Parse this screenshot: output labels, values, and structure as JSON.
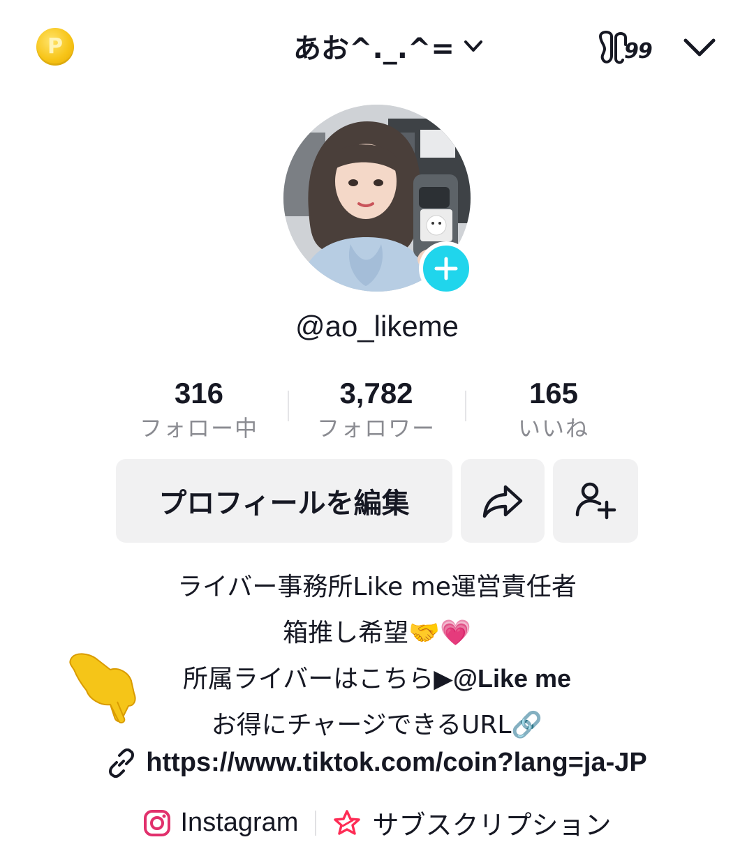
{
  "header": {
    "coin_label": "P",
    "display_name": "あお^._.^=",
    "notification_badge": "99",
    "icons": {
      "coin": "coin-icon",
      "title_chevron": "chevron-down-icon",
      "footprint": "footprint-icon",
      "account_switch": "chevron-down-icon"
    }
  },
  "profile": {
    "handle": "@ao_likeme",
    "avatar": "avatar-photo",
    "add_icon": "plus-icon"
  },
  "stats": [
    {
      "value": "316",
      "label": "フォロー中"
    },
    {
      "value": "3,782",
      "label": "フォロワー"
    },
    {
      "value": "165",
      "label": "いいね"
    }
  ],
  "actions": {
    "edit_profile": "プロフィールを編集",
    "share_icon": "share-icon",
    "add_friend_icon": "add-friend-icon"
  },
  "bio": {
    "line1": "ライバー事務所Like me運営責任者",
    "line2": "箱推し希望🤝💗",
    "line3_prefix": "所属ライバーはこちら▶",
    "line3_mention": "@Like me",
    "line4": "お得にチャージできるURL🔗",
    "pointer_icon": "pointing-hand-icon"
  },
  "link": {
    "url": "https://www.tiktok.com/coin?lang=ja-JP",
    "icon": "link-icon"
  },
  "social": {
    "instagram": "Instagram",
    "subscription": "サブスクリプション"
  },
  "colors": {
    "accent": "#20d5ec",
    "coin": "#f7c519",
    "button_bg": "#f1f1f2",
    "muted_text": "#8a8b91",
    "instagram": "#e1306c",
    "subscription": "#fe2c55"
  }
}
